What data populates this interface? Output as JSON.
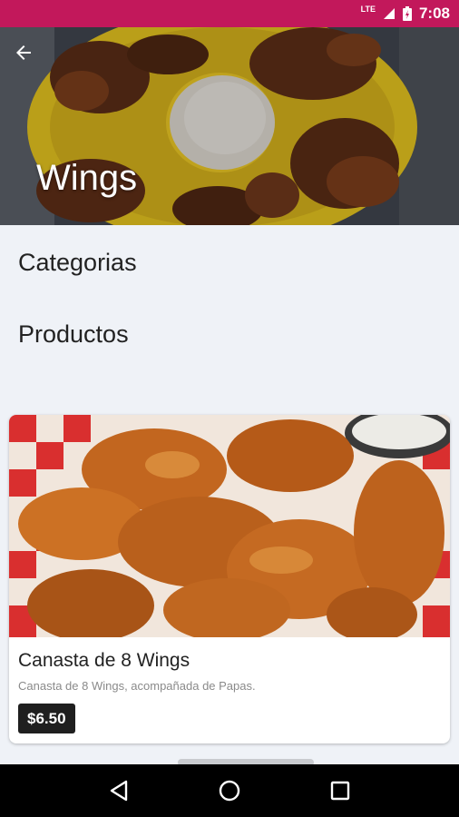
{
  "status_bar": {
    "network": "LTE",
    "time": "7:08"
  },
  "header": {
    "title": "Wings"
  },
  "sections": {
    "categories": "Categorias",
    "products": "Productos"
  },
  "product": {
    "name": "Canasta de 8 Wings",
    "description": "Canasta de 8 Wings, acompañada de Papas.",
    "price": "$6.50"
  },
  "colors": {
    "status_bar": "#c2185b",
    "price_badge": "#1f1f1f",
    "background": "#eff2f7"
  }
}
